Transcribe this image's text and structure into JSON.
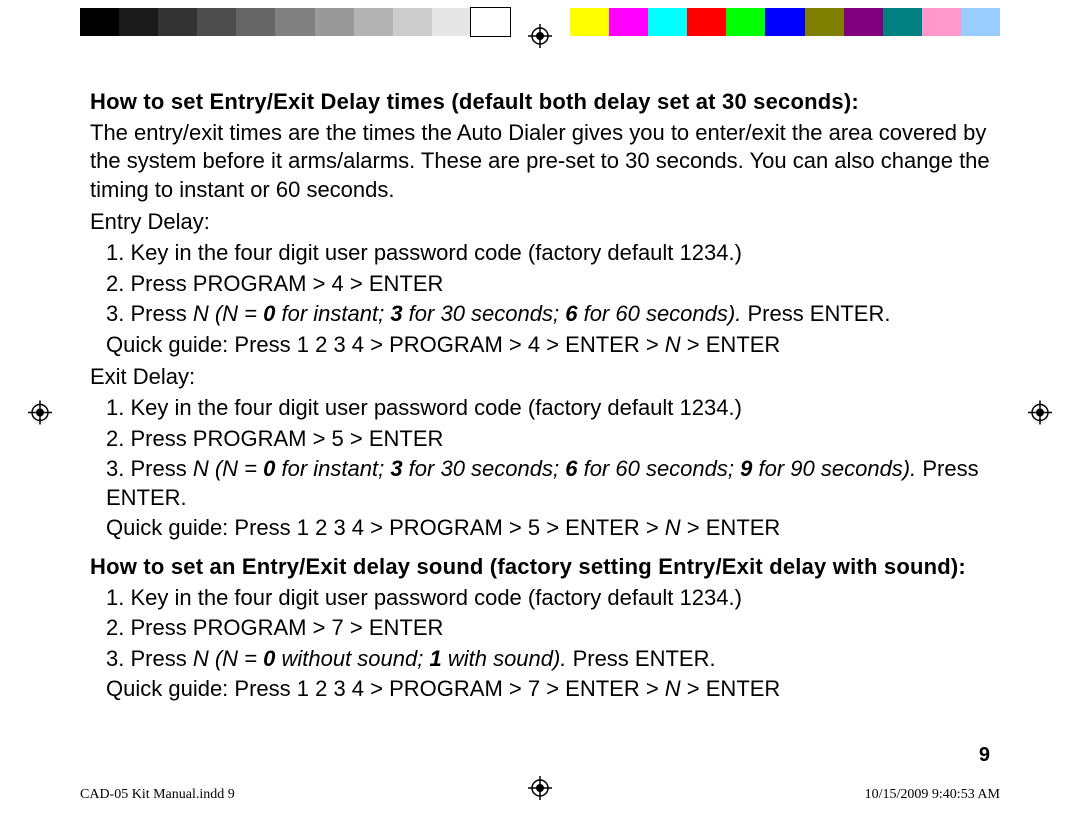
{
  "colorbars": {
    "grays": [
      "#000000",
      "#1a1a1a",
      "#333333",
      "#4d4d4d",
      "#666666",
      "#808080",
      "#999999",
      "#b3b3b3",
      "#cccccc",
      "#e6e6e6",
      "#ffffff"
    ],
    "colors": [
      "#ffff00",
      "#ff00ff",
      "#00ffff",
      "#ff0000",
      "#00ff00",
      "#0000ff",
      "#808000",
      "#800080",
      "#008080",
      "#ff99cc",
      "#99ccff"
    ]
  },
  "section1": {
    "heading": "How to set Entry/Exit Delay times (default both delay set at 30 seconds):",
    "intro": "The entry/exit times are the times the Auto Dialer gives you to enter/exit the area covered by the system before it arms/alarms. These are pre-set to 30 seconds. You can also change the timing to instant or 60 seconds.",
    "entry_label": "Entry Delay:",
    "entry_step1": "1. Key in the four digit user password code (factory default 1234.)",
    "entry_step2": "2. Press PROGRAM > 4 > ENTER",
    "entry_step3_a": "3. Press ",
    "entry_step3_n": "N (N = ",
    "entry_step3_b0": "0",
    "entry_step3_c1": " for instant; ",
    "entry_step3_b3": "3",
    "entry_step3_c2": " for 30 seconds; ",
    "entry_step3_b6": "6",
    "entry_step3_c3": " for 60 seconds).",
    "entry_step3_d": " Press ENTER.",
    "entry_qg_a": "Quick guide: Press 1 2 3 4 > PROGRAM > 4 > ENTER > ",
    "entry_qg_n": "N",
    "entry_qg_b": " > ENTER",
    "exit_label": "Exit Delay:",
    "exit_step1": "1. Key in the four digit user password code (factory default 1234.)",
    "exit_step2": "2. Press PROGRAM > 5 > ENTER",
    "exit_step3_a": "3. Press ",
    "exit_step3_n": "N (N = ",
    "exit_step3_b0": "0",
    "exit_step3_c1": " for instant; ",
    "exit_step3_b3": "3",
    "exit_step3_c2": " for 30 seconds; ",
    "exit_step3_b6": "6",
    "exit_step3_c3": " for 60 seconds; ",
    "exit_step3_b9": "9",
    "exit_step3_c4": " for 90 seconds).",
    "exit_step3_d": " Press ENTER.",
    "exit_qg_a": "Quick guide: Press 1 2 3 4 > PROGRAM > 5 > ENTER > ",
    "exit_qg_n": "N",
    "exit_qg_b": " > ENTER"
  },
  "section2": {
    "heading": "How to set an Entry/Exit delay sound (factory setting Entry/Exit delay with sound):",
    "step1": "1. Key in the four digit user password code (factory default 1234.)",
    "step2": "2. Press PROGRAM > 7 > ENTER",
    "step3_a": "3. Press ",
    "step3_n": "N (N = ",
    "step3_b0": "0",
    "step3_c1": " without sound; ",
    "step3_b1": "1",
    "step3_c2": " with sound).",
    "step3_d": " Press ENTER.",
    "qg_a": "Quick guide: Press 1 2 3 4 > PROGRAM > 7 > ENTER > ",
    "qg_n": "N",
    "qg_b": " > ENTER"
  },
  "page_number": "9",
  "footer_left": "CAD-05 Kit Manual.indd   9",
  "footer_right": "10/15/2009   9:40:53 AM"
}
